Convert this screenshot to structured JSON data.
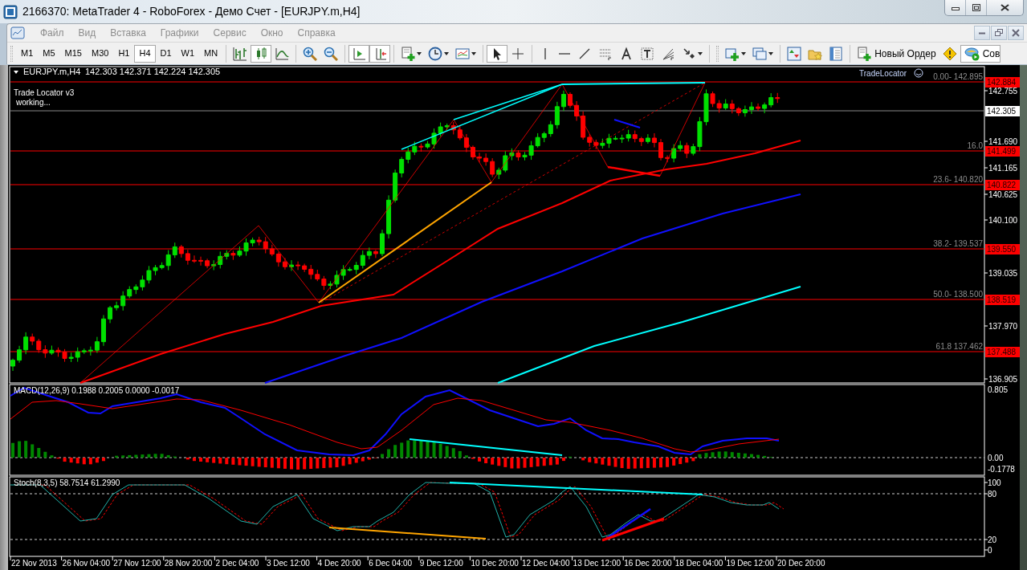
{
  "window": {
    "title": "2166370: MetaTrader 4 - RoboForex - Демо Счет - [EURJPY.m,H4]"
  },
  "menu": [
    {
      "label": "Файл",
      "disabled": true
    },
    {
      "label": "Вид",
      "disabled": true
    },
    {
      "label": "Вставка",
      "disabled": true
    },
    {
      "label": "Графики",
      "disabled": true
    },
    {
      "label": "Сервис",
      "disabled": true
    },
    {
      "label": "Окно",
      "disabled": true
    },
    {
      "label": "Справка",
      "disabled": true
    }
  ],
  "timeframes": [
    {
      "label": "M1",
      "selected": false
    },
    {
      "label": "M5",
      "selected": false
    },
    {
      "label": "M15",
      "selected": false
    },
    {
      "label": "M30",
      "selected": false
    },
    {
      "label": "H1",
      "selected": false
    },
    {
      "label": "H4",
      "selected": true
    },
    {
      "label": "D1",
      "selected": false
    },
    {
      "label": "W1",
      "selected": false
    },
    {
      "label": "MN",
      "selected": false
    }
  ],
  "new_order_button": "Новый Ордер",
  "experts_button": "Сов",
  "chart": {
    "symbol": "EURJPY.m,H4",
    "ohlc": "142.303 142.371 142.224 142.305",
    "indicator_name": "Trade Locator v3",
    "indicator_status": "working...",
    "indicator_badge": "TradeLocator",
    "price_axis": [
      "142.755",
      "141.690",
      "141.165",
      "140.625",
      "140.100",
      "139.035",
      "137.970",
      "136.905"
    ],
    "current_price": "142.305",
    "levels": [
      {
        "label": "0.00- 142.895",
        "price_tag": "142.884"
      },
      {
        "label": "16.0",
        "price_tag": "141.499"
      },
      {
        "label": "23.6- 140.820",
        "price_tag": "140.822"
      },
      {
        "label": "38.2- 139.537",
        "price_tag": "139.550"
      },
      {
        "label": "50.0- 138.500",
        "price_tag": "138.519"
      },
      {
        "label": "61.8 137.462",
        "price_tag": "137.488"
      }
    ]
  },
  "macd": {
    "label": "MACD(12,26,9) 0.1988 0.2005 0.0000 -0.0017",
    "axis": [
      "0.805",
      "0.00",
      "-0.1778"
    ]
  },
  "stochastic": {
    "label": "Stoch(8,3,5) 58.7514 61.2990",
    "axis": [
      "100",
      "80",
      "20",
      "0"
    ]
  },
  "time_axis": [
    "22 Nov 2013",
    "26 Nov 04:00",
    "27 Nov 12:00",
    "28 Nov 20:00",
    "2 Dec 04:00",
    "3 Dec 12:00",
    "4 Dec 20:00",
    "6 Dec 04:00",
    "9 Dec 12:00",
    "10 Dec 20:00",
    "12 Dec 04:00",
    "13 Dec 12:00",
    "16 Dec 20:00",
    "18 Dec 04:00",
    "19 Dec 12:00",
    "20 Dec 20:00"
  ]
}
